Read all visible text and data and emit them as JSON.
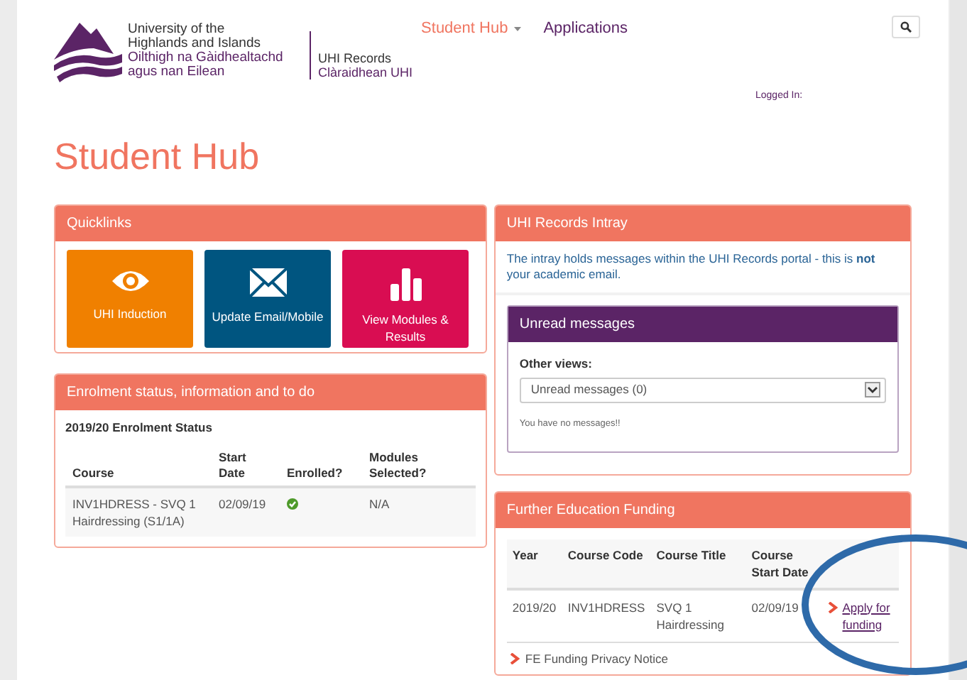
{
  "header": {
    "logo_lines": [
      "University of the",
      "Highlands and Islands",
      "Oilthigh na Gàidhealtachd",
      "agus nan Eilean"
    ],
    "system_lines": [
      "UHI Records",
      "Clàraidhean UHI"
    ],
    "nav": [
      {
        "label": "Student Hub",
        "selected": true,
        "dropdown": true
      },
      {
        "label": "Applications",
        "selected": false,
        "dropdown": false
      }
    ],
    "logged_in": "Logged In:"
  },
  "page_title": "Student Hub",
  "quicklinks": {
    "title": "Quicklinks",
    "tiles": [
      {
        "label": "UHI Induction",
        "kind": "eye",
        "color": "#f08000"
      },
      {
        "label": "Update Email/Mobile",
        "kind": "envelope",
        "color": "#005580"
      },
      {
        "label": "View Modules & Results",
        "kind": "bars",
        "color": "#d90d52"
      }
    ]
  },
  "enrolment": {
    "title": "Enrolment status, information and to do",
    "subtitle": "2019/20 Enrolment Status",
    "columns": [
      "Course",
      "Start Date",
      "Enrolled?",
      "Modules Selected?"
    ],
    "rows": [
      {
        "course": "INV1HDRESS - SVQ 1 Hairdressing (S1/1A)",
        "start_date": "02/09/19",
        "enrolled": true,
        "modules": "N/A"
      }
    ]
  },
  "intray": {
    "title": "UHI Records Intray",
    "intro": "The intray holds messages within the UHI Records portal - this is **not** your academic email.",
    "unread": {
      "title": "Unread messages",
      "label": "Other views:",
      "value": "Unread messages (0)",
      "empty": "You have no messages!!"
    }
  },
  "funding": {
    "title": "Further Education Funding",
    "columns": [
      "Year",
      "Course Code",
      "Course Title",
      "Course Start Date"
    ],
    "rows": [
      {
        "year": "2019/20",
        "code": "INV1HDRESS",
        "course_title": "SVQ 1 Hairdressing",
        "start": "02/09/19",
        "link": "Apply for funding"
      }
    ],
    "footer_link": "FE Funding Privacy Notice"
  }
}
